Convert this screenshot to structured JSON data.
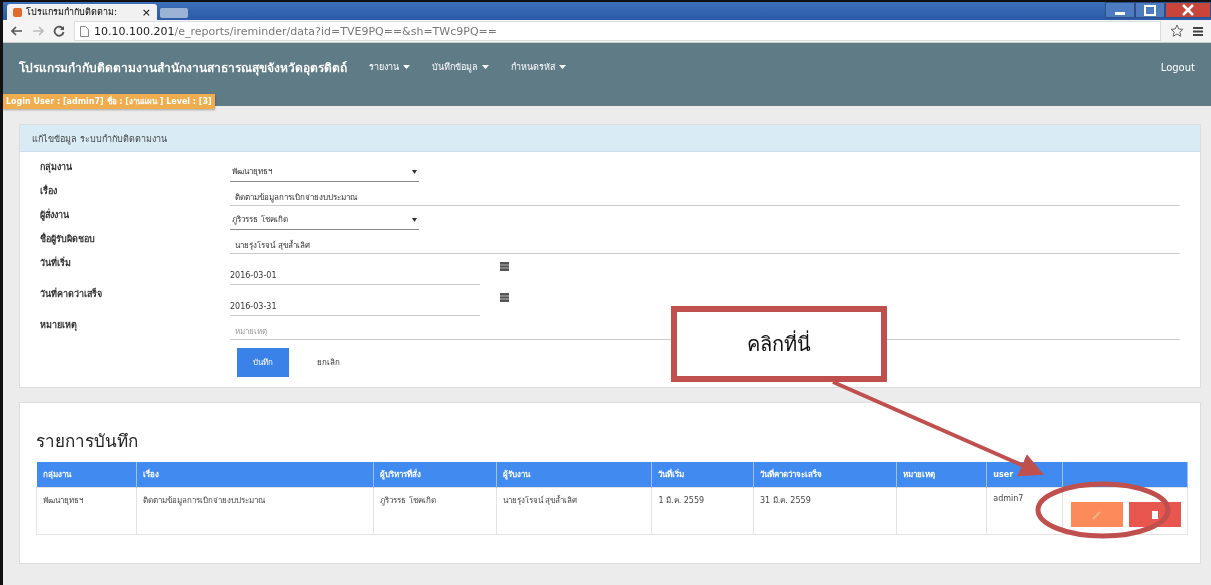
{
  "browser": {
    "tab_title": "โปรแกรมกำกับติดตาม:",
    "tab_close": "×",
    "url_host": "10.10.100.201",
    "url_path": "/e_reports/ireminder/data?id=TVE9PQ==&sh=TWc9PQ=="
  },
  "navbar": {
    "brand": "โปรแกรมกำกับติดตามงานสำนักงานสาธารณสุขจังหวัดอุตรดิตถ์",
    "menus": [
      "รายงาน",
      "บันทึกข้อมูล",
      "กำหนดรหัส"
    ],
    "logout": "Logout",
    "login_info": "Login User : [admin7] ชื่อ : [งานแผน ] Level : [3]"
  },
  "form": {
    "title": "แก้ไขข้อมูล ระบบกำกับติดตามงาน",
    "fields": [
      {
        "kind": "select",
        "label": "กลุ่มงาน",
        "value": "พัฒนายุทธฯ"
      },
      {
        "kind": "text",
        "label": "เรื่อง",
        "value": "ติดตามข้อมูลการเบิกจ่ายงบประมาณ"
      },
      {
        "kind": "select",
        "label": "ผู้สั่งงาน",
        "value": "ภูริวรรธ โชคเกิด"
      },
      {
        "kind": "text",
        "label": "ชื่อผู้รับผิดชอบ",
        "value": "นายรุ่งโรจน์ สุขล้ำเลิศ"
      },
      {
        "kind": "date",
        "label": "วันที่เริ่ม",
        "value": "2016-03-01"
      },
      {
        "kind": "date",
        "label": "วันที่คาดว่าเสร็จ",
        "value": "2016-03-31"
      },
      {
        "kind": "text",
        "label": "หมายเหตุ",
        "placeholder": "หมายเหตุ"
      }
    ],
    "save_button": "บันทึก",
    "cancel_link": "ยกเลิก"
  },
  "records": {
    "title": "รายการบันทึก",
    "columns": [
      "กลุ่มงาน",
      "เรื่อง",
      "ผู้บริหารที่สั่ง",
      "ผู้รับงาน",
      "วันที่เริ่ม",
      "วันที่คาดว่าจะเสร็จ",
      "หมายเหตุ",
      "user"
    ],
    "rows": [
      [
        "พัฒนายุทธฯ",
        "ติดตามข้อมูลการเบิกจ่ายงบประมาณ",
        "ภูริวรรธ โชคเกิด",
        "นายรุ่งโรจน์ สุขล้ำเลิศ",
        "1 มี.ค. 2559",
        "31 มี.ค. 2559",
        null,
        "admin7"
      ]
    ]
  },
  "callout": {
    "text": "คลิกที่นี่"
  }
}
